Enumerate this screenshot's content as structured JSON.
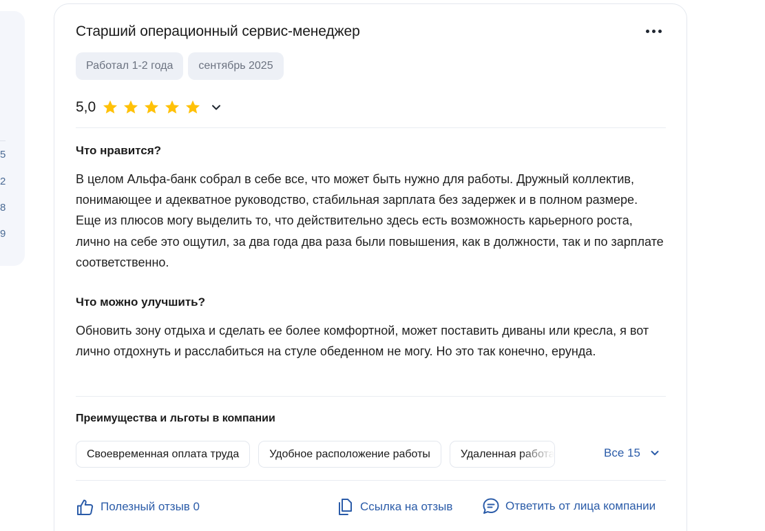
{
  "side_panel": {
    "numbers": [
      "5",
      "2",
      "8",
      "9"
    ]
  },
  "review": {
    "title": "Старший операционный сервис-менеджер",
    "tags": [
      "Работал 1-2 года",
      "сентябрь 2025"
    ],
    "rating": {
      "value_label": "5,0",
      "stars": 5,
      "max_stars": 5,
      "star_color": "#ffc107"
    },
    "likes": {
      "heading": "Что нравится?",
      "text": "В целом Альфа-банк собрал в себе все, что может быть нужно для работы. Дружный коллектив, понимающее и адекватное руководство, стабильная зарплата без задержек и в полном размере. Еще из плюсов могу выделить то, что действительно здесь есть возможность карьерного роста, лично на себе это ощутил, за два года два раза были повышения, как в должности, так и по зарплате соответственно."
    },
    "improve": {
      "heading": "Что можно улучшить?",
      "text": "Обновить зону отдыха и сделать ее более комфортной, может поставить диваны или кресла, я вот лично отдохнуть и расслабиться на стуле обеденном не могу. Но это так конечно, ерунда."
    },
    "benefits": {
      "heading": "Преимущества и льготы в компании",
      "chips": [
        "Своевременная оплата труда",
        "Удобное расположение работы",
        "Удаленная работа"
      ],
      "all_label": "Все 15"
    },
    "actions": {
      "useful_label": "Полезный отзыв 0",
      "link_label": "Ссылка на отзыв",
      "reply_label": "Ответить от лица компании"
    }
  },
  "colors": {
    "accent": "#2a5ba8",
    "star": "#ffc107",
    "tag_bg": "#edf0f6"
  }
}
